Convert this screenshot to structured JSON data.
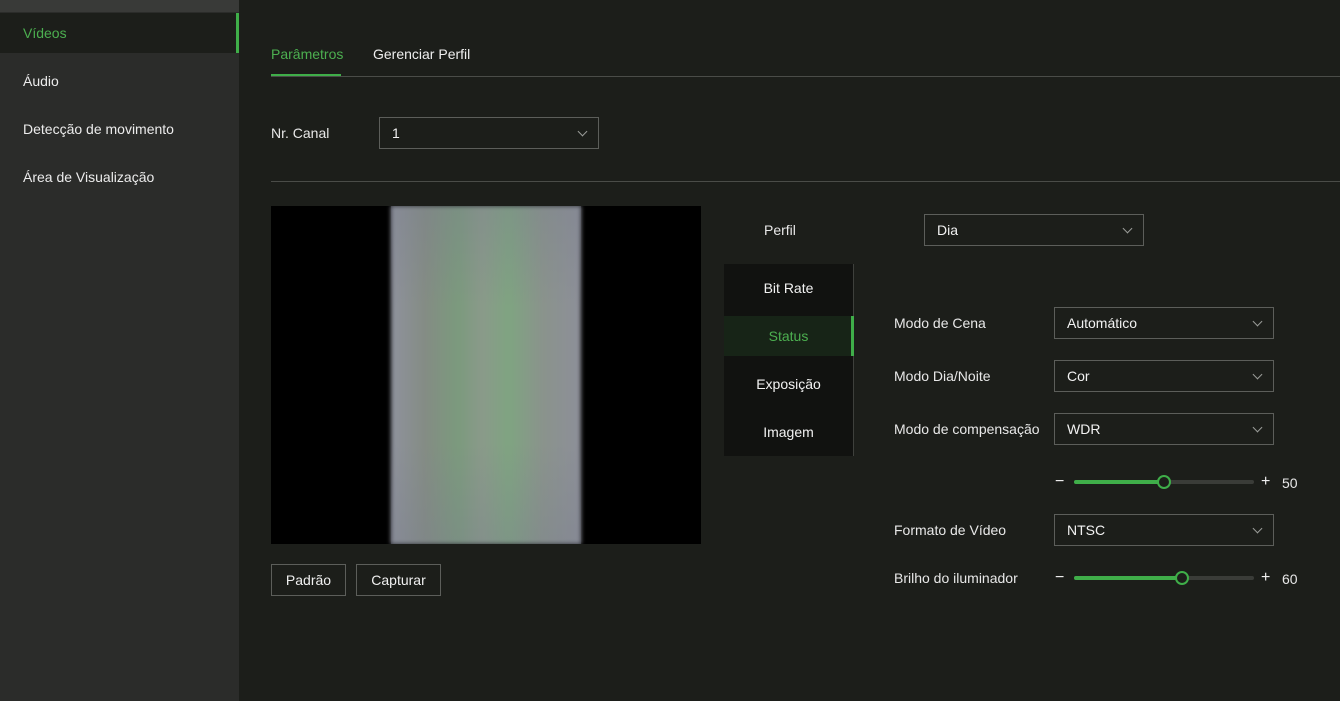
{
  "sidebar": {
    "items": [
      {
        "label": "Vídeos",
        "active": true
      },
      {
        "label": "Áudio",
        "active": false
      },
      {
        "label": "Detecção de movimento",
        "active": false
      },
      {
        "label": "Área de Visualização",
        "active": false
      }
    ]
  },
  "tabs": [
    {
      "label": "Parâmetros",
      "active": true
    },
    {
      "label": "Gerenciar Perfil",
      "active": false
    }
  ],
  "channel": {
    "label": "Nr. Canal",
    "value": "1"
  },
  "profile": {
    "label": "Perfil",
    "value": "Dia"
  },
  "buttons": {
    "default_label": "Padrão",
    "capture_label": "Capturar"
  },
  "submenu": [
    {
      "label": "Bit Rate",
      "active": false
    },
    {
      "label": "Status",
      "active": true
    },
    {
      "label": "Exposição",
      "active": false
    },
    {
      "label": "Imagem",
      "active": false
    }
  ],
  "settings": {
    "scene_mode": {
      "label": "Modo de Cena",
      "value": "Automático"
    },
    "day_night_mode": {
      "label": "Modo Dia/Noite",
      "value": "Cor"
    },
    "compensation_mode": {
      "label": "Modo de compensação",
      "value": "WDR"
    },
    "wdr_level": {
      "minus": "−",
      "plus": "+",
      "value": 50,
      "fraction": 0.5
    },
    "video_format": {
      "label": "Formato de Vídeo",
      "value": "NTSC"
    },
    "illuminator": {
      "label": "Brilho do iluminador",
      "minus": "−",
      "plus": "+",
      "value": 60,
      "fraction": 0.6
    }
  },
  "colors": {
    "accent": "#3fae49",
    "background": "#1c1e1a",
    "sidebar": "#2b2c2a"
  }
}
